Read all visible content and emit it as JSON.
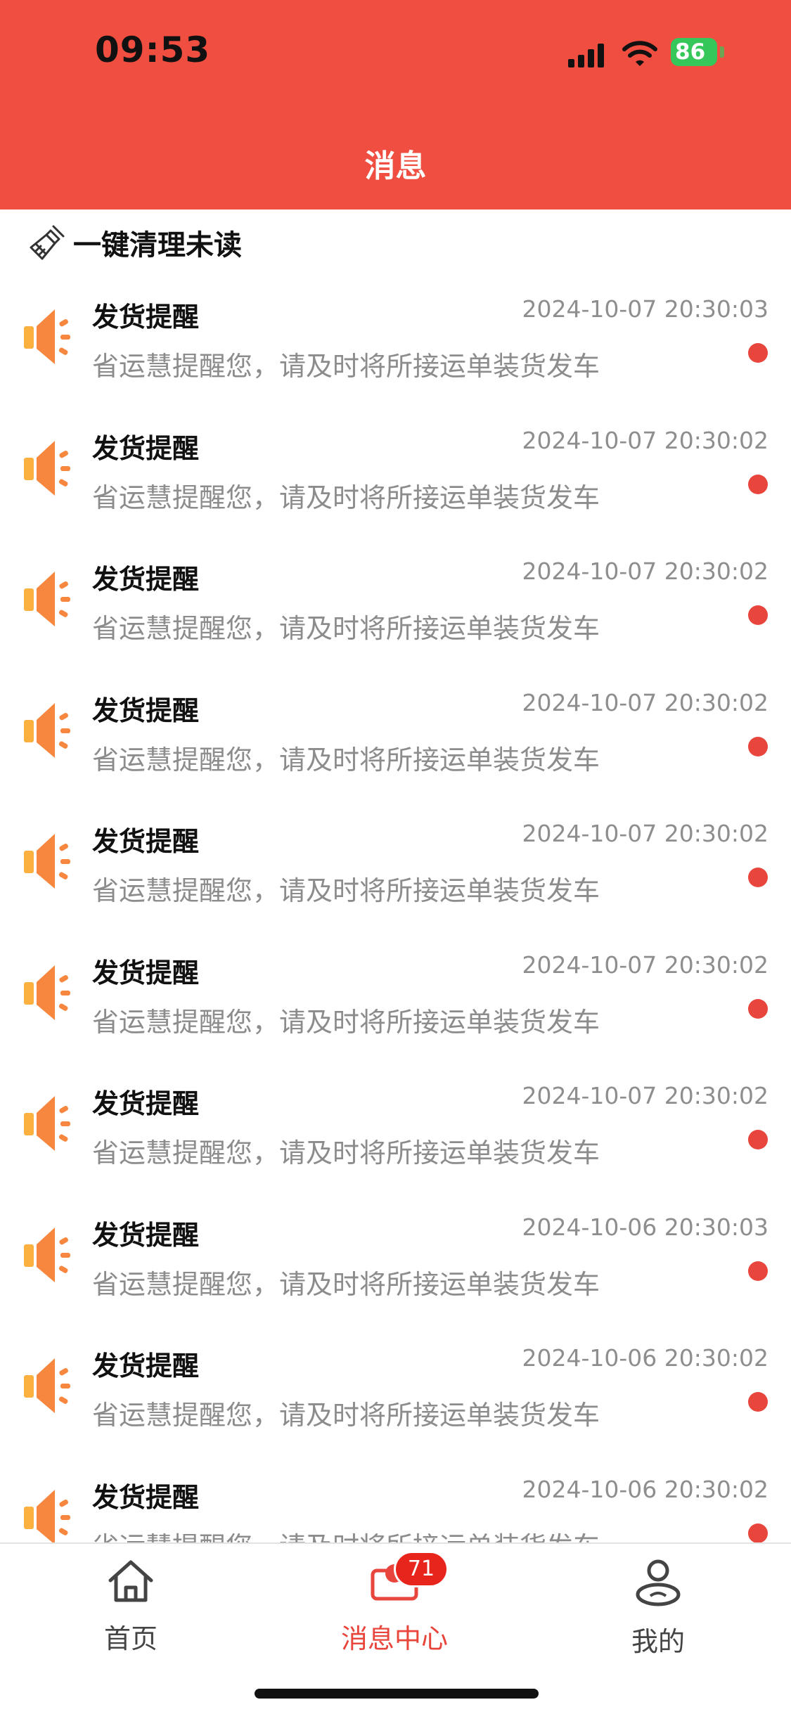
{
  "status_bar": {
    "time": "09:53",
    "battery": "86"
  },
  "header": {
    "title": "消息"
  },
  "toolbar": {
    "clear_unread_label": "一键清理未读"
  },
  "messages": [
    {
      "title": "发货提醒",
      "time": "2024-10-07 20:30:03",
      "body": "省运慧提醒您，请及时将所接运单装货发车",
      "unread": true
    },
    {
      "title": "发货提醒",
      "time": "2024-10-07 20:30:02",
      "body": "省运慧提醒您，请及时将所接运单装货发车",
      "unread": true
    },
    {
      "title": "发货提醒",
      "time": "2024-10-07 20:30:02",
      "body": "省运慧提醒您，请及时将所接运单装货发车",
      "unread": true
    },
    {
      "title": "发货提醒",
      "time": "2024-10-07 20:30:02",
      "body": "省运慧提醒您，请及时将所接运单装货发车",
      "unread": true
    },
    {
      "title": "发货提醒",
      "time": "2024-10-07 20:30:02",
      "body": "省运慧提醒您，请及时将所接运单装货发车",
      "unread": true
    },
    {
      "title": "发货提醒",
      "time": "2024-10-07 20:30:02",
      "body": "省运慧提醒您，请及时将所接运单装货发车",
      "unread": true
    },
    {
      "title": "发货提醒",
      "time": "2024-10-07 20:30:02",
      "body": "省运慧提醒您，请及时将所接运单装货发车",
      "unread": true
    },
    {
      "title": "发货提醒",
      "time": "2024-10-06 20:30:03",
      "body": "省运慧提醒您，请及时将所接运单装货发车",
      "unread": true
    },
    {
      "title": "发货提醒",
      "time": "2024-10-06 20:30:02",
      "body": "省运慧提醒您，请及时将所接运单装货发车",
      "unread": true
    },
    {
      "title": "发货提醒",
      "time": "2024-10-06 20:30:02",
      "body": "省运慧提醒您，请及时将所接运单装货发车",
      "unread": true
    }
  ],
  "tabbar": {
    "home_label": "首页",
    "messages_label": "消息中心",
    "messages_badge": "71",
    "mine_label": "我的",
    "active": "messages"
  },
  "colors": {
    "header": "#ef4e40",
    "accent": "#e8453c",
    "icon_orange": "#f7873f"
  }
}
